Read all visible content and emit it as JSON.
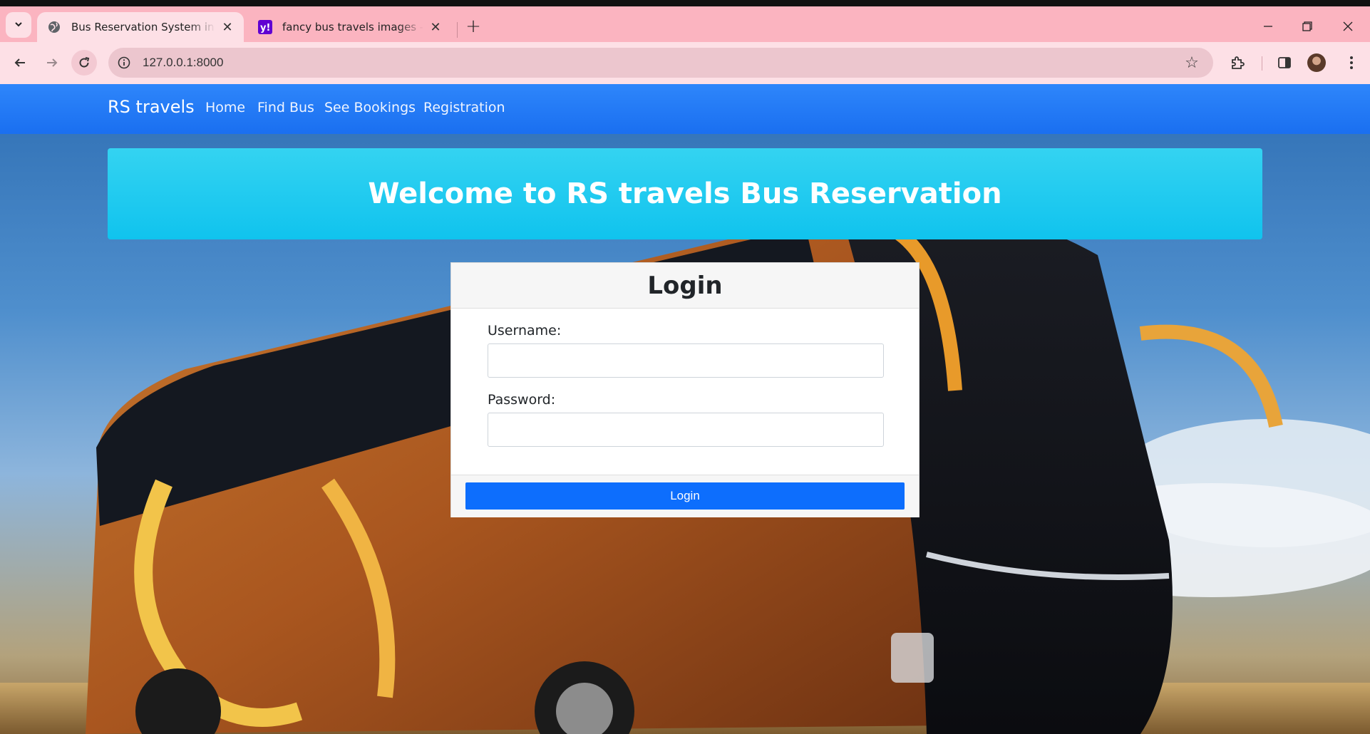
{
  "browser": {
    "tabs": [
      {
        "title": "Bus Reservation System in Djan",
        "active": true,
        "favicon": "globe-icon"
      },
      {
        "title": "fancy bus travels images - Yaho",
        "active": false,
        "favicon": "yahoo-icon"
      }
    ],
    "url": "127.0.0.1:8000",
    "colors": {
      "tabstrip": "#fbb4c0",
      "toolbar": "#fde0e6"
    }
  },
  "site": {
    "brand": "RS travels",
    "nav": [
      "Home",
      "Find Bus",
      "See Bookings",
      "Registration"
    ],
    "banner": "Welcome to RS travels Bus Reservation",
    "colors": {
      "navbar": "#1a6ff0",
      "banner": "#10c3ee",
      "button": "#0d6efd"
    }
  },
  "login": {
    "title": "Login",
    "username_label": "Username:",
    "password_label": "Password:",
    "username_value": "",
    "password_value": "",
    "submit_label": "Login"
  }
}
